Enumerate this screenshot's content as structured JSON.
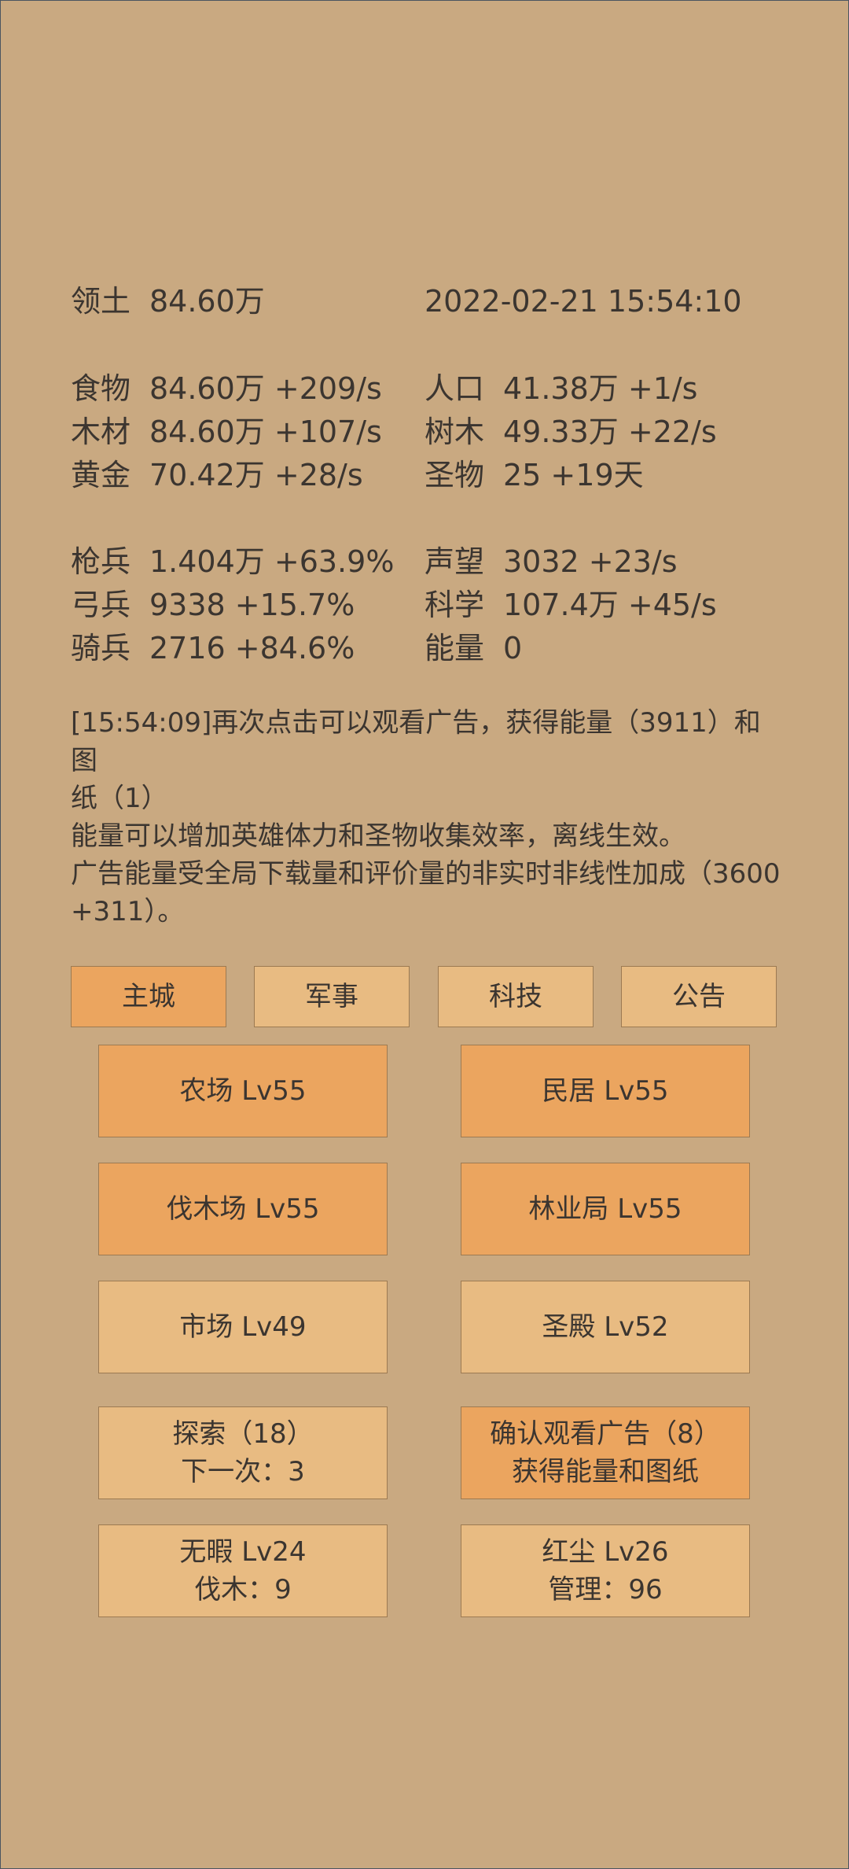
{
  "header": {
    "territory_label": "领土",
    "territory_value": "84.60万",
    "datetime": "2022-02-21 15:54:10"
  },
  "resources": [
    {
      "label": "食物",
      "value": "84.60万 +209/s"
    },
    {
      "label": "人口",
      "value": "41.38万 +1/s"
    },
    {
      "label": "木材",
      "value": "84.60万 +107/s"
    },
    {
      "label": "树木",
      "value": "49.33万 +22/s"
    },
    {
      "label": "黄金",
      "value": "70.42万 +28/s"
    },
    {
      "label": "圣物",
      "value": "25 +19天"
    }
  ],
  "military": [
    {
      "label": "枪兵",
      "value": "1.404万 +63.9%"
    },
    {
      "label": "声望",
      "value": "3032 +23/s"
    },
    {
      "label": "弓兵",
      "value": "9338 +15.7%"
    },
    {
      "label": "科学",
      "value": "107.4万 +45/s"
    },
    {
      "label": "骑兵",
      "value": "2716 +84.6%"
    },
    {
      "label": "能量",
      "value": "0"
    }
  ],
  "log": {
    "line1": "[15:54:09]再次点击可以观看广告，获得能量（3911）和图",
    "line2": "纸（1）",
    "line3": "能量可以增加英雄体力和圣物收集效率，离线生效。",
    "line4": "广告能量受全局下载量和评价量的非实时非线性加成（3600",
    "line5": "+311）。"
  },
  "tabs": [
    {
      "label": "主城",
      "active": true
    },
    {
      "label": "军事",
      "active": false
    },
    {
      "label": "科技",
      "active": false
    },
    {
      "label": "公告",
      "active": false
    }
  ],
  "buildings": {
    "farm": "农场 Lv55",
    "house": "民居 Lv55",
    "lumber": "伐木场 Lv55",
    "forestry": "林业局 Lv55",
    "market": "市场 Lv49",
    "temple": "圣殿 Lv52"
  },
  "actions": {
    "explore_line1": "探索（18）",
    "explore_line2": "下一次：3",
    "ad_line1": "确认观看广告（8）",
    "ad_line2": "获得能量和图纸"
  },
  "heroes": {
    "hero1_line1": "无暇 Lv24",
    "hero1_line2": "伐木：9",
    "hero2_line1": "红尘 Lv26",
    "hero2_line2": "管理：96"
  },
  "colors": {
    "background": "#c9a981",
    "button_light": "#e8bb82",
    "button_active": "#eba55f",
    "text": "#3b3530"
  }
}
